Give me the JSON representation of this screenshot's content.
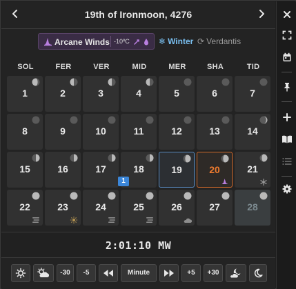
{
  "header": {
    "prev_label": "‹",
    "next_label": "›",
    "title": "19th of Ironmoon, 4276"
  },
  "weather": {
    "condition": "Arcane Winds",
    "temperature": "-10ºC",
    "season": "Winter",
    "cycle": "Verdantis",
    "icons": [
      "wizard-hat-icon",
      "wind-icon",
      "raindrop-icon",
      "snowflake-icon",
      "refresh-icon"
    ],
    "accent_color": "#3a2c45",
    "season_color": "#79bff0"
  },
  "weekdays": [
    "SOL",
    "FER",
    "VER",
    "MID",
    "MER",
    "SHA",
    "TID"
  ],
  "days": [
    {
      "n": "1",
      "moon": "waning-gibbous"
    },
    {
      "n": "2",
      "moon": "last-quarter"
    },
    {
      "n": "3",
      "moon": "last-quarter"
    },
    {
      "n": "4",
      "moon": "last-quarter"
    },
    {
      "n": "5",
      "moon": "new"
    },
    {
      "n": "6",
      "moon": "new"
    },
    {
      "n": "7",
      "moon": "new"
    },
    {
      "n": "8",
      "moon": "new"
    },
    {
      "n": "9",
      "moon": "new"
    },
    {
      "n": "10",
      "moon": "new"
    },
    {
      "n": "11",
      "moon": "new"
    },
    {
      "n": "12",
      "moon": "new"
    },
    {
      "n": "13",
      "moon": "new"
    },
    {
      "n": "14",
      "moon": "waxing-crescent"
    },
    {
      "n": "15",
      "moon": "first-quarter"
    },
    {
      "n": "16",
      "moon": "first-quarter"
    },
    {
      "n": "17",
      "moon": "first-quarter"
    },
    {
      "n": "18",
      "moon": "first-quarter",
      "events": "1"
    },
    {
      "n": "19",
      "moon": "waxing-gibbous",
      "state": "selected"
    },
    {
      "n": "20",
      "moon": "waxing-gibbous",
      "state": "today",
      "weather": "wizard-hat-icon"
    },
    {
      "n": "21",
      "moon": "waxing-gibbous",
      "weather": "snowflake-icon"
    },
    {
      "n": "22",
      "moon": "full",
      "weather": "fog-icon"
    },
    {
      "n": "23",
      "moon": "full",
      "weather": "sun-icon"
    },
    {
      "n": "24",
      "moon": "full",
      "weather": "fog-icon"
    },
    {
      "n": "25",
      "moon": "full",
      "weather": "fog-icon"
    },
    {
      "n": "26",
      "moon": "full",
      "weather": "cloud-icon"
    },
    {
      "n": "27",
      "moon": "full"
    },
    {
      "n": "28",
      "moon": "full",
      "state": "dimmed"
    }
  ],
  "clock": {
    "time": "2:01:10 MW"
  },
  "controls": {
    "minus30": "-30",
    "minus5": "-5",
    "unit": "Minute",
    "plus5": "+5",
    "plus30": "+30",
    "icons": [
      "sunrise-gear-icon",
      "sun-cloud-icon",
      "rewind-icon",
      "fast-forward-icon",
      "moon-cloud-icon",
      "moon-icon"
    ]
  },
  "sidebar": {
    "icons": [
      "close-icon",
      "fullscreen-icon",
      "calendar-icon",
      "pin-icon",
      "add-icon",
      "book-icon",
      "list-icon",
      "gear-icon"
    ]
  },
  "colors": {
    "selected_border": "#5a8cc2",
    "today_border": "#d36a2a",
    "today_text": "#f07b2e",
    "event_badge": "#3b86d8"
  }
}
